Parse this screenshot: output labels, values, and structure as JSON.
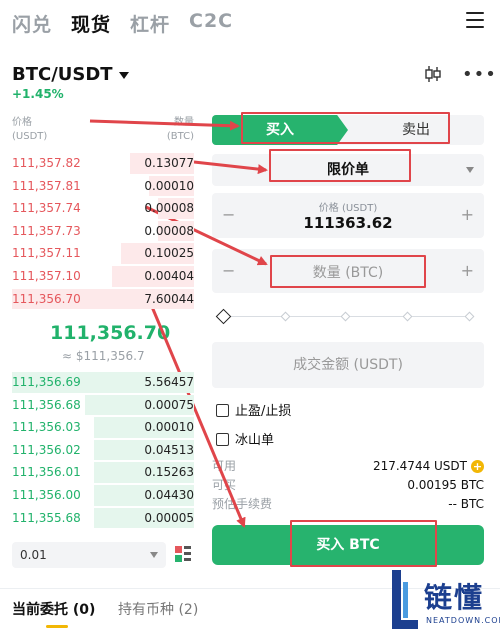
{
  "top_tabs": [
    "闪兑",
    "现货",
    "杠杆",
    "C2C"
  ],
  "active_top_tab": "现货",
  "pair": {
    "symbol": "BTC/USDT",
    "change": "+1.45%"
  },
  "orderbook": {
    "header_price": "价格",
    "header_price_unit": "(USDT)",
    "header_qty": "数量",
    "header_qty_unit": "(BTC)",
    "asks": [
      {
        "price": "111,357.82",
        "qty": "0.13077",
        "depth": 0.35
      },
      {
        "price": "111,357.81",
        "qty": "0.00010",
        "depth": 0.25
      },
      {
        "price": "111,357.74",
        "qty": "0.00008",
        "depth": 0.2
      },
      {
        "price": "111,357.73",
        "qty": "0.00008",
        "depth": 0.2
      },
      {
        "price": "111,357.11",
        "qty": "0.10025",
        "depth": 0.4
      },
      {
        "price": "111,357.10",
        "qty": "0.00404",
        "depth": 0.45
      },
      {
        "price": "111,356.70",
        "qty": "7.60044",
        "depth": 1.0
      }
    ],
    "last_price": "111,356.70",
    "fiat_price": "≈ $111,356.7",
    "bids": [
      {
        "price": "111,356.69",
        "qty": "5.56457",
        "depth": 1.0
      },
      {
        "price": "111,356.68",
        "qty": "0.00075",
        "depth": 0.6
      },
      {
        "price": "111,356.03",
        "qty": "0.00010",
        "depth": 0.55
      },
      {
        "price": "111,356.02",
        "qty": "0.04513",
        "depth": 0.55
      },
      {
        "price": "111,356.01",
        "qty": "0.15263",
        "depth": 0.55
      },
      {
        "price": "111,356.00",
        "qty": "0.04430",
        "depth": 0.55
      },
      {
        "price": "111,355.68",
        "qty": "0.00005",
        "depth": 0.55
      }
    ],
    "precision": "0.01"
  },
  "trade_panel": {
    "buy_tab": "买入",
    "sell_tab": "卖出",
    "order_type": "限价单",
    "price_label": "价格 (USDT)",
    "price_value": "111363.62",
    "qty_placeholder": "数量 (BTC)",
    "amount_placeholder": "成交金额 (USDT)",
    "tp_sl": "止盈/止损",
    "iceberg": "冰山单",
    "available_label": "可用",
    "available_value": "217.4744 USDT",
    "buyable_label": "可买",
    "buyable_value": "0.00195 BTC",
    "fee_label": "预估手续费",
    "fee_value": "-- BTC",
    "buy_button": "买入 BTC"
  },
  "bottom_tabs": {
    "open_orders": "当前委托 (0)",
    "holdings": "持有币种 (2)"
  },
  "watermark": {
    "brand": "链懂",
    "url": "NEATDOWN.COM"
  },
  "colors": {
    "buy": "#27b36e",
    "sell": "#e5575c",
    "annotation": "#e0454a",
    "accent": "#f2b705"
  }
}
